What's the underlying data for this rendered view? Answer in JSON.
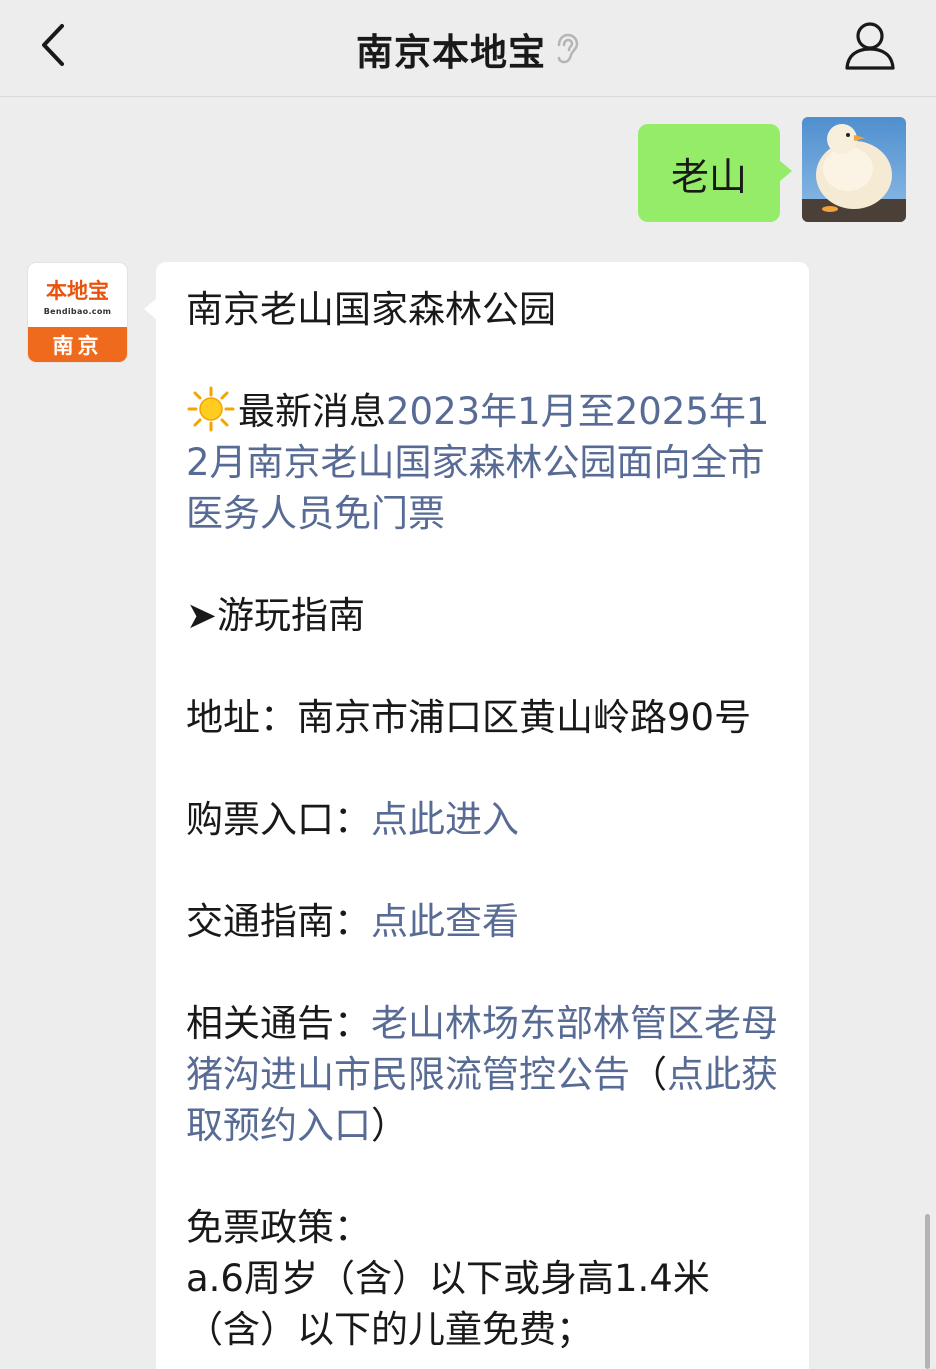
{
  "header": {
    "title": "南京本地宝",
    "back_icon": "chevron-left-icon",
    "ear_icon": "ear-icon",
    "profile_icon": "user-icon"
  },
  "messages": {
    "sent": {
      "text": "老山"
    },
    "bot_avatar": {
      "brand": "本地宝",
      "domain": "Bendibao.com",
      "city": "南京"
    },
    "reply": {
      "title": "南京老山国家森林公园",
      "news_prefix": "最新消息",
      "news_link": "2023年1月至2025年12月南京老山国家森林公园面向全市医务人员免门票",
      "guide_heading": "➤游玩指南",
      "address_label": "地址：",
      "address_value": "南京市浦口区黄山岭路90号",
      "ticket_label": "购票入口：",
      "ticket_link": "点此进入",
      "traffic_label": "交通指南：",
      "traffic_link": "点此查看",
      "notice_label": "相关通告：",
      "notice_link": "老山林场东部林管区老母猪沟进山市民限流管控公告",
      "notice_paren_open": "（",
      "notice_sub_link": "点此获取预约入口",
      "notice_paren_close": "）",
      "policy_heading": "免票政策：",
      "policy_a": "a.6周岁（含）以下或身高1.4米（含）以下的儿童免费；"
    }
  },
  "colors": {
    "background": "#ededed",
    "sent_bubble": "#95ec69",
    "link": "#576b95",
    "brand_orange": "#f06a1e"
  }
}
